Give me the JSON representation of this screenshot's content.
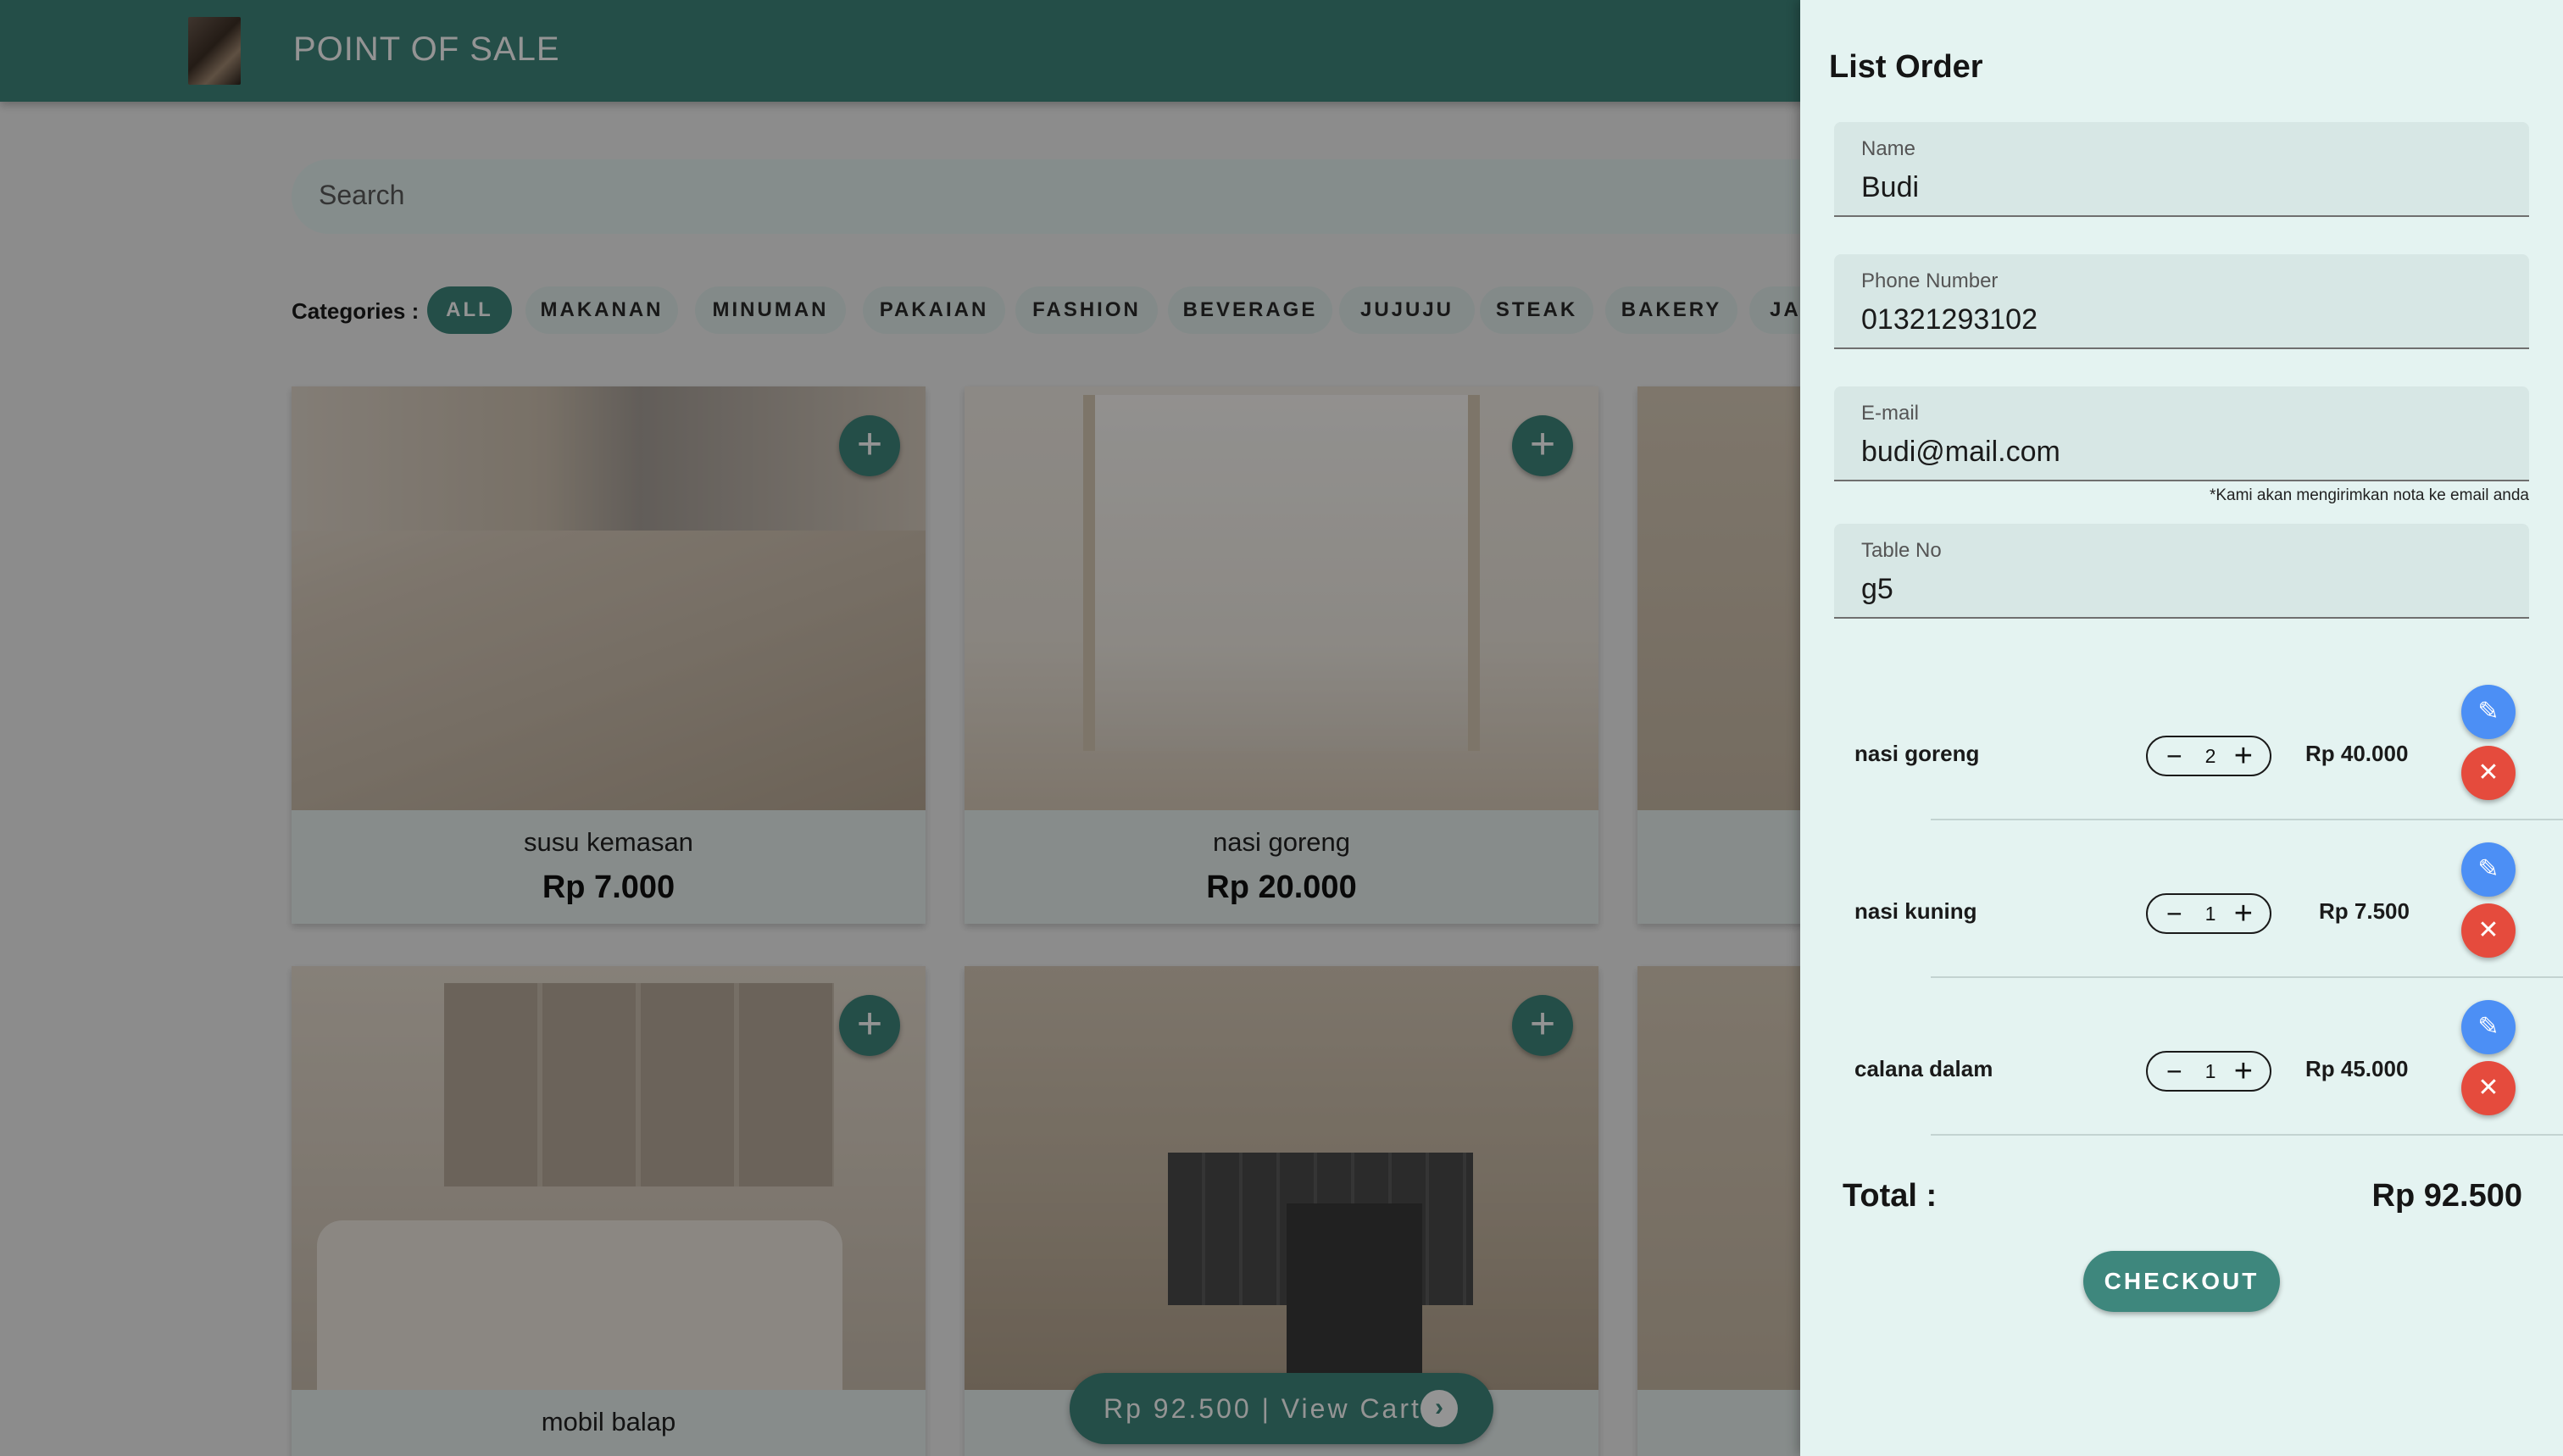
{
  "header": {
    "title": "POINT OF SALE",
    "logo_icon": "store-logo"
  },
  "search": {
    "placeholder": "Search"
  },
  "categories": {
    "label": "Categories :",
    "items": [
      "ALL",
      "MAKANAN",
      "MINUMAN",
      "PAKAIAN",
      "FASHION",
      "BEVERAGE",
      "JUJUJU",
      "STEAK",
      "BAKERY",
      "JA"
    ],
    "active": "ALL"
  },
  "products": [
    {
      "name": "susu kemasan",
      "price": "Rp 7.000"
    },
    {
      "name": "nasi goreng",
      "price": "Rp 20.000"
    },
    {
      "name": "mobil balap",
      "price": ""
    }
  ],
  "cart_bar": {
    "label": "Rp 92.500 | View Cart"
  },
  "order": {
    "title": "List Order",
    "fields": {
      "name": {
        "label": "Name",
        "value": "Budi"
      },
      "phone": {
        "label": "Phone Number",
        "value": "01321293102"
      },
      "email": {
        "label": "E-mail",
        "value": "budi@mail.com",
        "note": "*Kami akan mengirimkan nota ke email anda"
      },
      "table": {
        "label": "Table No",
        "value": "g5"
      }
    },
    "items": [
      {
        "name": "nasi goreng",
        "qty": "2",
        "price": "Rp 40.000"
      },
      {
        "name": "nasi kuning",
        "qty": "1",
        "price": "Rp 7.500"
      },
      {
        "name": "calana dalam",
        "qty": "1",
        "price": "Rp 45.000"
      }
    ],
    "total_label": "Total :",
    "total_value": "Rp 92.500",
    "checkout_label": "CHECKOUT"
  },
  "colors": {
    "primary": "#3e877d",
    "drawer_bg": "#e4f3f1",
    "edit": "#4c8ff5",
    "delete": "#e54b3d"
  }
}
